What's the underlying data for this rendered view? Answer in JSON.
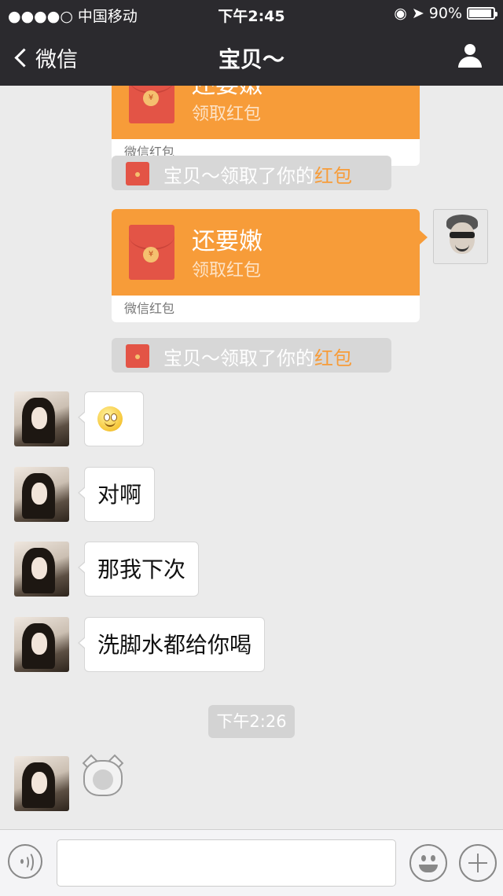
{
  "status_bar": {
    "carrier": "●●●●○ 中国移动",
    "time": "下午2:45",
    "battery": "90%",
    "icons": [
      "signal-icon",
      "wifi-icon",
      "lock-rotation-icon",
      "location-icon",
      "battery-icon"
    ]
  },
  "nav": {
    "back_label": "微信",
    "title": "宝贝～"
  },
  "messages": {
    "red_packet_1": {
      "title": "还要嫩",
      "subtitle": "领取红包",
      "footer": "微信红包"
    },
    "system_1": {
      "prefix": "宝贝～领取了你的",
      "highlight": "红包"
    },
    "red_packet_2": {
      "title": "还要嫩",
      "subtitle": "领取红包",
      "footer": "微信红包"
    },
    "system_2": {
      "prefix": "宝贝～领取了你的",
      "highlight": "红包"
    },
    "bubble_2": "对啊",
    "bubble_3": "那我下次",
    "bubble_4": "洗脚水都给你喝",
    "timestamp": "下午2:26"
  },
  "colors": {
    "nav_bg": "#2b2a2e",
    "red_packet": "#f79c39",
    "chat_bg": "#ebebeb"
  }
}
